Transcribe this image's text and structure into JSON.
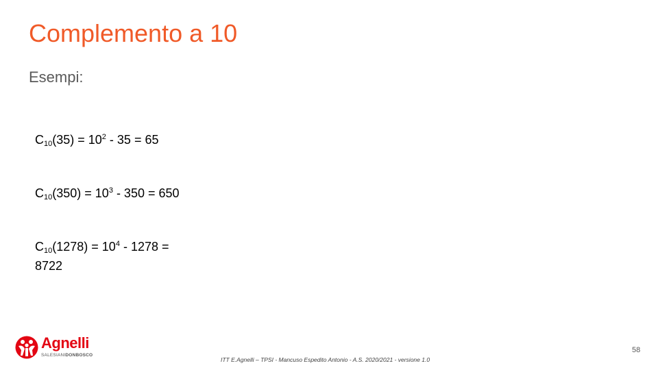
{
  "slide": {
    "title": "Complemento a 10",
    "subtitle": "Esempi:",
    "examples": [
      {
        "c": "C",
        "sub": "10",
        "arg": "(35)  =  10",
        "exp": "2",
        "rest": " - 35 = 65"
      },
      {
        "c": "C",
        "sub": "10",
        "arg": "(350)  =  10",
        "exp": "3",
        "rest": " - 350 = 650"
      },
      {
        "c": "C",
        "sub": "10",
        "arg": "(1278)  =  10",
        "exp": "4",
        "rest": " - 1278 =",
        "line2": "8722"
      }
    ],
    "footer": "ITT E.Agnelli – TPSI  - Mancuso Espedito Antonio - A.S. 2020/2021   - versione 1.0",
    "page_number": "58"
  },
  "logo": {
    "word": "Agnelli",
    "tag_light": "SALESIANI",
    "tag_bold": "DONBOSCO",
    "icon": "agnelli-logo-icon"
  },
  "colors": {
    "title": "#f05a28",
    "subtitle": "#595959",
    "brand": "#e30613"
  }
}
